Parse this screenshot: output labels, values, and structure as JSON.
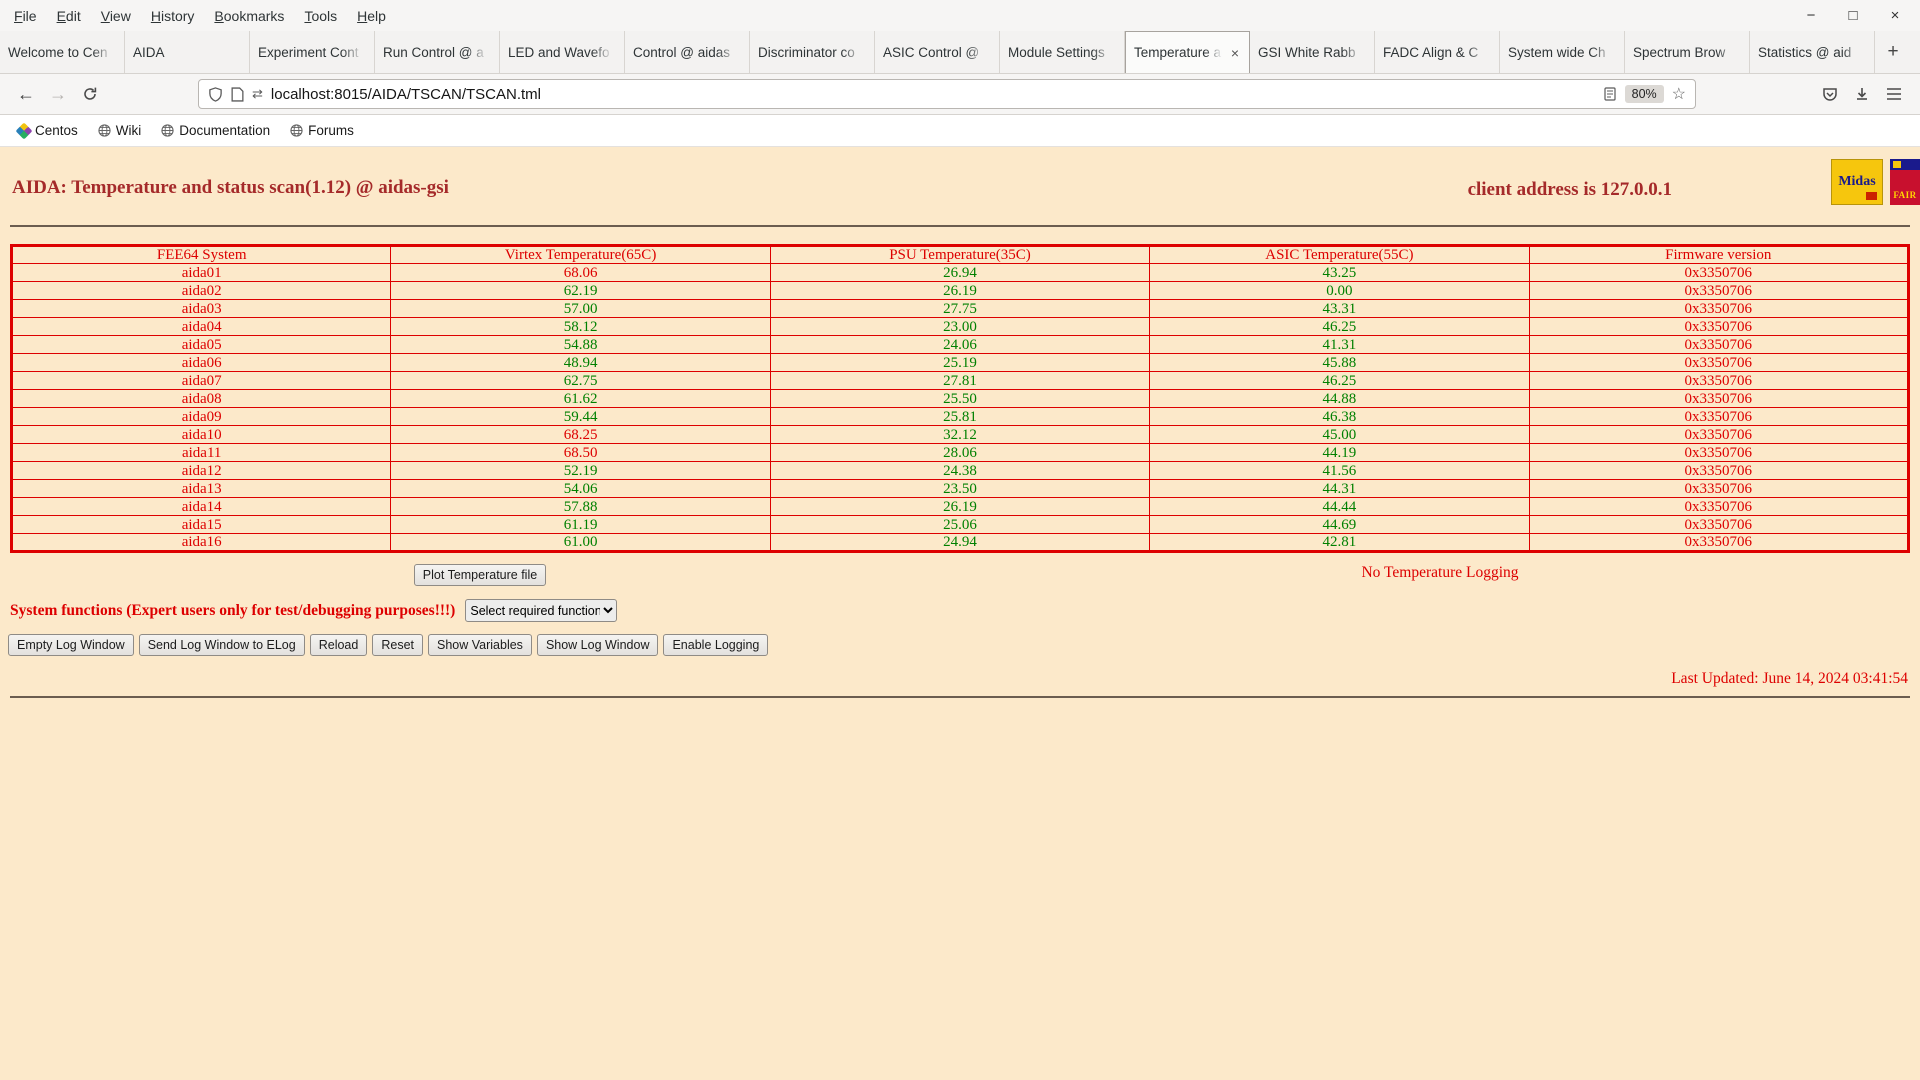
{
  "colors": {
    "page_bg": "#FCE9CA",
    "red": "#DD0000",
    "green": "#008000",
    "maroon": "#A52A2A",
    "chrome_bg": "#F6F5F4"
  },
  "icons": {
    "back": "←",
    "forward": "→",
    "star": "☆",
    "permissions": "⇄",
    "minimize": "−",
    "maximize": "□",
    "close": "×"
  },
  "browser": {
    "menu": [
      "File",
      "Edit",
      "View",
      "History",
      "Bookmarks",
      "Tools",
      "Help"
    ],
    "window_controls": [
      {
        "name": "minimize",
        "glyph": "−"
      },
      {
        "name": "maximize",
        "glyph": "□"
      },
      {
        "name": "close",
        "glyph": "×"
      }
    ],
    "tabs": [
      "Welcome to Cen",
      "AIDA",
      "Experiment Cont",
      "Run Control @ a",
      "LED and Wavefo",
      "Control @ aidas",
      "Discriminator co",
      "ASIC Control @",
      "Module Settings",
      "Temperature an",
      "GSI White Rabb",
      "FADC Align & C",
      "System wide Ch",
      "Spectrum Brow",
      "Statistics @ aid"
    ],
    "active_tab_index": 9,
    "tab_close_glyph": "×",
    "new_tab_label": "+",
    "url": "localhost:8015/AIDA/TSCAN/TSCAN.tml",
    "zoom_level": "80%",
    "bookmarks": [
      "Centos",
      "Wiki",
      "Documentation",
      "Forums"
    ]
  },
  "page": {
    "title": "AIDA: Temperature and status scan(1.12) @ aidas-gsi",
    "client_address": "client address is 127.0.0.1",
    "logos": {
      "midas": "Midas",
      "fair": "FAIR"
    },
    "table": {
      "headers": [
        "FEE64 System",
        "Virtex Temperature(65C)",
        "PSU Temperature(35C)",
        "ASIC Temperature(55C)",
        "Firmware version"
      ],
      "thresholds": {
        "virtex": 65,
        "psu": 35,
        "asic": 55
      },
      "rows": [
        {
          "system": "aida01",
          "virtex": "68.06",
          "psu": "26.94",
          "asic": "43.25",
          "firmware": "0x3350706"
        },
        {
          "system": "aida02",
          "virtex": "62.19",
          "psu": "26.19",
          "asic": "0.00",
          "firmware": "0x3350706"
        },
        {
          "system": "aida03",
          "virtex": "57.00",
          "psu": "27.75",
          "asic": "43.31",
          "firmware": "0x3350706"
        },
        {
          "system": "aida04",
          "virtex": "58.12",
          "psu": "23.00",
          "asic": "46.25",
          "firmware": "0x3350706"
        },
        {
          "system": "aida05",
          "virtex": "54.88",
          "psu": "24.06",
          "asic": "41.31",
          "firmware": "0x3350706"
        },
        {
          "system": "aida06",
          "virtex": "48.94",
          "psu": "25.19",
          "asic": "45.88",
          "firmware": "0x3350706"
        },
        {
          "system": "aida07",
          "virtex": "62.75",
          "psu": "27.81",
          "asic": "46.25",
          "firmware": "0x3350706"
        },
        {
          "system": "aida08",
          "virtex": "61.62",
          "psu": "25.50",
          "asic": "44.88",
          "firmware": "0x3350706"
        },
        {
          "system": "aida09",
          "virtex": "59.44",
          "psu": "25.81",
          "asic": "46.38",
          "firmware": "0x3350706"
        },
        {
          "system": "aida10",
          "virtex": "68.25",
          "psu": "32.12",
          "asic": "45.00",
          "firmware": "0x3350706"
        },
        {
          "system": "aida11",
          "virtex": "68.50",
          "psu": "28.06",
          "asic": "44.19",
          "firmware": "0x3350706"
        },
        {
          "system": "aida12",
          "virtex": "52.19",
          "psu": "24.38",
          "asic": "41.56",
          "firmware": "0x3350706"
        },
        {
          "system": "aida13",
          "virtex": "54.06",
          "psu": "23.50",
          "asic": "44.31",
          "firmware": "0x3350706"
        },
        {
          "system": "aida14",
          "virtex": "57.88",
          "psu": "26.19",
          "asic": "44.44",
          "firmware": "0x3350706"
        },
        {
          "system": "aida15",
          "virtex": "61.19",
          "psu": "25.06",
          "asic": "44.69",
          "firmware": "0x3350706"
        },
        {
          "system": "aida16",
          "virtex": "61.00",
          "psu": "24.94",
          "asic": "42.81",
          "firmware": "0x3350706"
        }
      ]
    },
    "plot_button_label": "Plot Temperature file",
    "logging_status": "No Temperature Logging",
    "system_functions_label": "System functions (Expert users only for test/debugging purposes!!!)",
    "function_select_value": "Select required function",
    "action_buttons": [
      "Empty Log Window",
      "Send Log Window to ELog",
      "Reload",
      "Reset",
      "Show Variables",
      "Show Log Window",
      "Enable Logging"
    ],
    "last_updated": "Last Updated: June 14, 2024 03:41:54"
  }
}
